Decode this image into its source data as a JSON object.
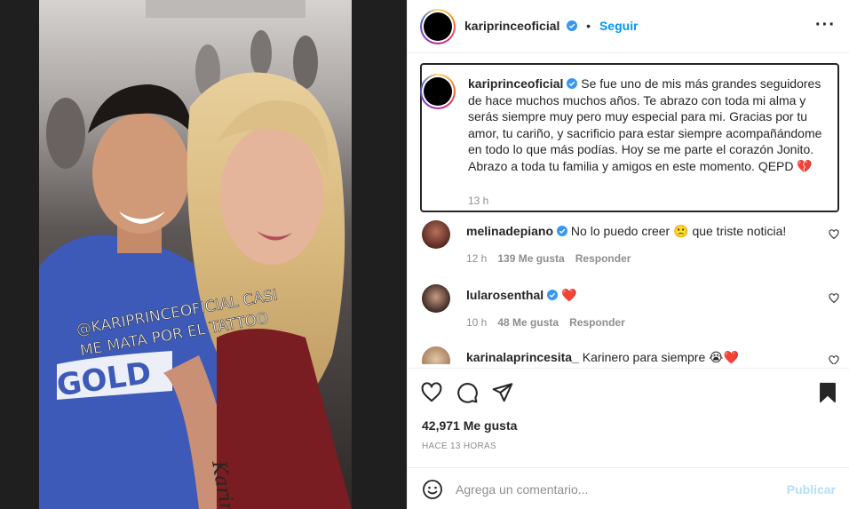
{
  "post": {
    "author": "kariprinceoficial",
    "follow_label": "Seguir",
    "more_icon": "more-horizontal-icon",
    "photo_text": {
      "tattoo_line1": "@KARIPRINCEOFICIAL CASI",
      "tattoo_line2": "ME MATA POR EL TATTOO",
      "shirt": "GOLD",
      "arm": "Karina"
    }
  },
  "caption": {
    "username": "kariprinceoficial",
    "text": "Se fue uno de mis más grandes seguidores de hace muchos muchos años. Te abrazo con toda mi alma y serás siempre muy pero muy especial para mi. Gracias por tu amor, tu cariño, y sacrificio para estar siempre acompañándome en todo lo que más podías. Hoy se me parte el corazón Jonito. Abrazo a toda tu familia y amigos en este momento. QEPD",
    "emoji": "💔",
    "time": "13 h"
  },
  "comments": [
    {
      "username": "melinadepiano",
      "verified": true,
      "text": "No lo puedo creer",
      "emoji": "🙁",
      "text2": "que triste noticia!",
      "time": "12 h",
      "likes": "139 Me gusta",
      "reply": "Responder"
    },
    {
      "username": "lularosenthal",
      "verified": true,
      "text": "",
      "emoji": "❤️",
      "text2": "",
      "time": "10 h",
      "likes": "48 Me gusta",
      "reply": "Responder"
    },
    {
      "username": "karinalaprincesita_",
      "verified": false,
      "text": "Karinero para siempre",
      "emoji": "😭❤️",
      "text2": "",
      "time": "",
      "likes": "",
      "reply": ""
    }
  ],
  "actions": {
    "likes": "42,971 Me gusta",
    "time_ago": "HACE 13 HORAS"
  },
  "add_comment": {
    "placeholder": "Agrega un comentario...",
    "publish_label": "Publicar"
  },
  "colors": {
    "accent": "#0095f6",
    "publish_disabled": "#b2dffc",
    "verified": "#3897f0",
    "heart": "#ed4956"
  }
}
